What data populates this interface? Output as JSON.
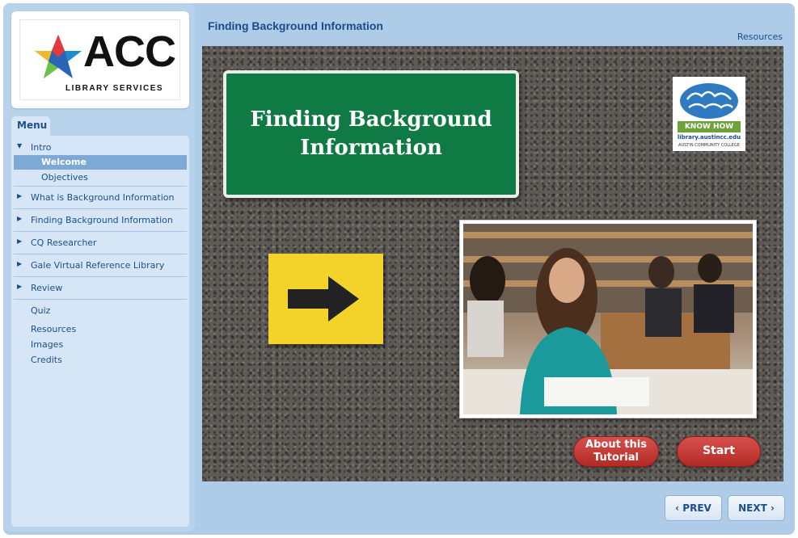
{
  "header": {
    "title": "Finding Background Information",
    "resources_link": "Resources"
  },
  "logo": {
    "text": "ACC",
    "subtitle": "LIBRARY SERVICES"
  },
  "menu": {
    "tab_label": "Menu",
    "items": [
      {
        "label": "Intro",
        "arrow": "▼"
      },
      {
        "label": "Welcome",
        "selected": true
      },
      {
        "label": "Objectives"
      },
      {
        "label": "What is Background Information",
        "arrow": "▶"
      },
      {
        "label": "Finding Background Information",
        "arrow": "▶"
      },
      {
        "label": "CQ Researcher",
        "arrow": "▶"
      },
      {
        "label": "Gale Virtual Reference Library",
        "arrow": "▶"
      },
      {
        "label": "Review",
        "arrow": "▶"
      },
      {
        "label": "Quiz"
      },
      {
        "label": "Resources"
      },
      {
        "label": "Images"
      },
      {
        "label": "Credits"
      }
    ]
  },
  "slide": {
    "sign_text": "Finding Background Information",
    "badge_title": "KNOW HOW",
    "badge_url": "library.austincc.edu",
    "badge_org": "AUSTIN COMMUNITY COLLEGE",
    "about_button": "About this Tutorial",
    "start_button": "Start"
  },
  "nav": {
    "prev": "‹ PREV",
    "next": "NEXT ›"
  },
  "colors": {
    "accent": "#1a4d88",
    "button_red": "#c23a35",
    "sign_green": "#0f7a43",
    "arrow_yellow": "#f3d32a"
  }
}
